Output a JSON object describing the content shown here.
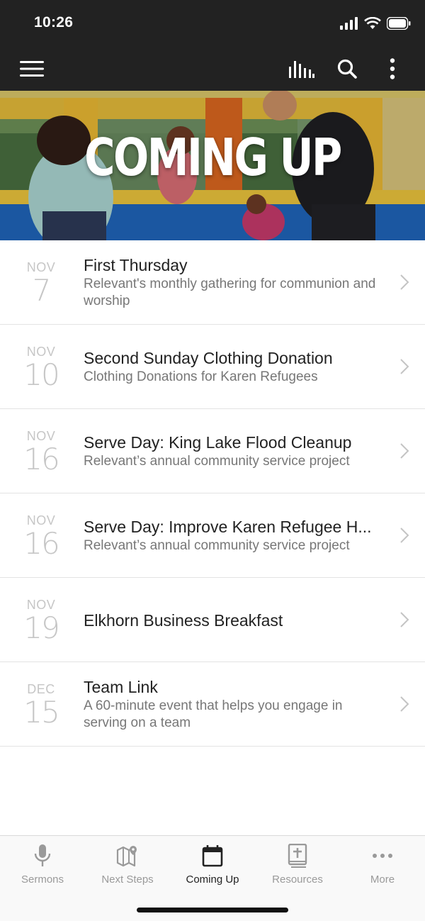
{
  "status_bar": {
    "time": "10:26"
  },
  "app_bar": {
    "icons": [
      "menu-icon",
      "bar-chart-icon",
      "search-icon",
      "more-vertical-icon"
    ],
    "background": "#222222"
  },
  "hero": {
    "title": "COMING UP"
  },
  "events": [
    {
      "month": "NOV",
      "day": "7",
      "title": "First Thursday",
      "description": "Relevant's monthly gathering for communion and worship"
    },
    {
      "month": "NOV",
      "day": "10",
      "title": "Second Sunday Clothing Donation",
      "description": "Clothing Donations for Karen Refugees"
    },
    {
      "month": "NOV",
      "day": "16",
      "title": "Serve Day: King Lake Flood Cleanup",
      "description": "Relevant’s annual community service project"
    },
    {
      "month": "NOV",
      "day": "16",
      "title": "Serve Day: Improve Karen Refugee H...",
      "description": "Relevant’s annual community service project"
    },
    {
      "month": "NOV",
      "day": "19",
      "title": "Elkhorn Business Breakfast",
      "description": ""
    },
    {
      "month": "DEC",
      "day": "15",
      "title": "Team Link",
      "description": "A 60-minute event that helps you engage in serving on a team"
    }
  ],
  "tab_bar": {
    "active": "Coming Up",
    "tabs": [
      {
        "label": "Sermons",
        "icon": "microphone-icon"
      },
      {
        "label": "Next Steps",
        "icon": "map-pin-icon"
      },
      {
        "label": "Coming Up",
        "icon": "calendar-icon"
      },
      {
        "label": "Resources",
        "icon": "bible-icon"
      },
      {
        "label": "More",
        "icon": "more-horizontal-icon"
      }
    ]
  },
  "colors": {
    "active_tab": "#222222",
    "inactive_tab": "#9a9a9a",
    "date_text": "#c6c6c6"
  }
}
